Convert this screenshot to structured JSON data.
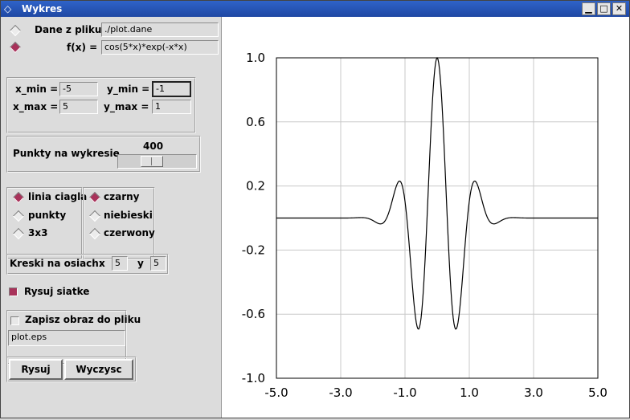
{
  "window": {
    "title": "Wykres",
    "buttons": [
      "minimize",
      "maximize",
      "close"
    ]
  },
  "source": {
    "file_label": "Dane z pliku:",
    "file_value": "./plot.dane",
    "func_label": "f(x) =",
    "func_value": "cos(5*x)*exp(-x*x)",
    "selected": "function"
  },
  "range": {
    "xmin_label": "x_min =",
    "xmin_value": "-5",
    "ymin_label": "y_min =",
    "ymin_value": "-1",
    "xmax_label": "x_max =",
    "xmax_value": "5",
    "ymax_label": "y_max =",
    "ymax_value": "1"
  },
  "points": {
    "label": "Punkty na wykresie",
    "value": "400",
    "fraction": 0.4
  },
  "style": {
    "items": [
      {
        "label": "linia ciagla",
        "checked": true
      },
      {
        "label": "punkty",
        "checked": false
      },
      {
        "label": "3x3",
        "checked": false
      }
    ]
  },
  "color": {
    "items": [
      {
        "label": "czarny",
        "checked": true
      },
      {
        "label": "niebieski",
        "checked": false
      },
      {
        "label": "czerwony",
        "checked": false
      }
    ]
  },
  "ticks": {
    "label": "Kreski na osiach:",
    "x_label": "x",
    "x_value": "5",
    "y_label": "y",
    "y_value": "5"
  },
  "grid": {
    "label": "Rysuj siatke",
    "checked": true
  },
  "save": {
    "label": "Zapisz obraz do pliku",
    "checked": false,
    "filename": "plot.eps"
  },
  "actions": {
    "draw": "Rysuj",
    "clear": "Wyczysc"
  },
  "chart_data": {
    "type": "line",
    "function": "cos(5*x)*exp(-x*x)",
    "xlim": [
      -5,
      5
    ],
    "ylim": [
      -1,
      1
    ],
    "xticks": [
      "-5.0",
      "-3.0",
      "-1.0",
      "1.0",
      "3.0",
      "5.0"
    ],
    "yticks": [
      "1.0",
      "0.6",
      "0.2",
      "-0.2",
      "-0.6",
      "-1.0"
    ],
    "n_points": 400,
    "grid": true,
    "line_color": "#000000"
  }
}
